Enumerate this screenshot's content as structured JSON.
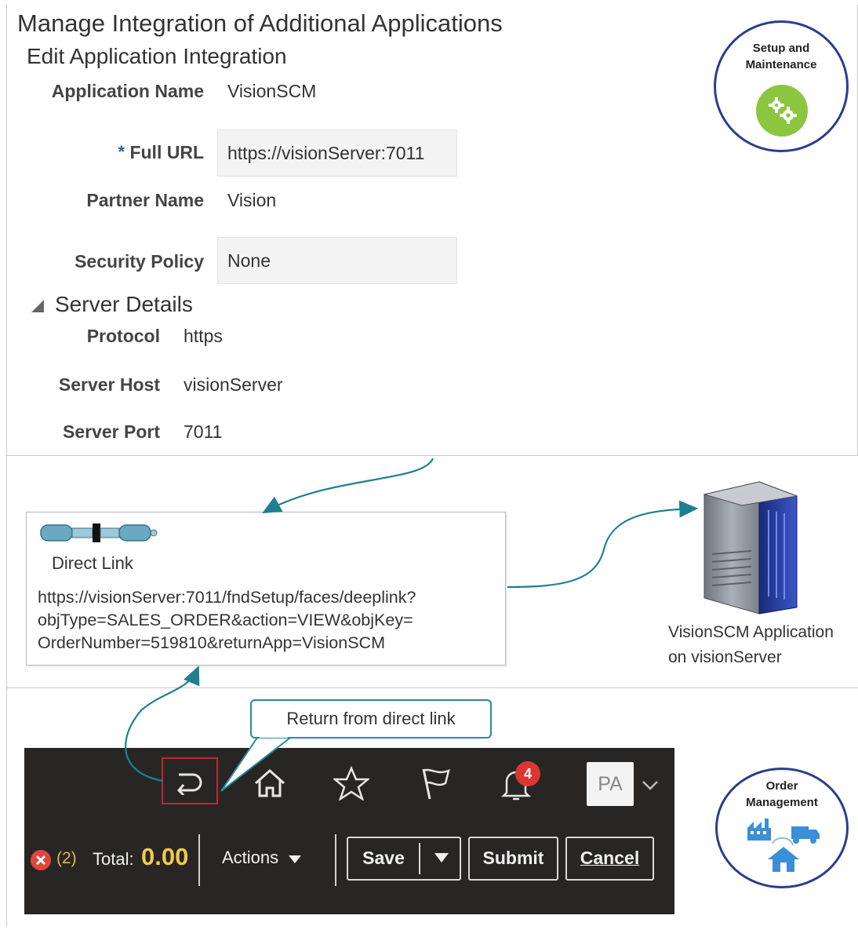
{
  "form": {
    "title": "Manage Integration of Additional Applications",
    "subtitle": "Edit Application Integration",
    "fields": [
      {
        "label": "Application Name",
        "value": "VisionSCM"
      },
      {
        "label": "Full URL",
        "required_mark": "*",
        "value": "https://visionServer:7011"
      },
      {
        "label": "Partner Name",
        "value": "Vision"
      },
      {
        "label": "Security Policy",
        "value": "None"
      }
    ],
    "server_details": {
      "title": "Server Details",
      "fields": [
        {
          "label": "Protocol",
          "value": "https"
        },
        {
          "label": "Server Host",
          "value": "visionServer"
        },
        {
          "label": "Server Port",
          "value": "7011"
        }
      ]
    }
  },
  "badges": {
    "setup": {
      "line1": "Setup and",
      "line2": "Maintenance",
      "icon": "gears-icon",
      "color": "#8cc63f"
    },
    "order": {
      "line1": "Order",
      "line2": "Management",
      "icon": "factory-truck-house-icon",
      "color": "#3b8fd6"
    }
  },
  "direct_link": {
    "label": "Direct Link",
    "icon": "cable-connector-icon",
    "url_lines": [
      "https://visionServer:7011/fndSetup/faces/deeplink?",
      "objType=SALES_ORDER&action=VIEW&objKey=",
      "OrderNumber=519810&returnApp=VisionSCM"
    ]
  },
  "server": {
    "icon": "server-tower-icon",
    "caption_line1": "VisionSCM Application",
    "caption_line2": "on visionServer"
  },
  "callout": {
    "text": "Return from direct link"
  },
  "app_header": {
    "notification_count": "4",
    "avatar_initials": "PA",
    "error_count": "(2)",
    "total_label": "Total:",
    "total_value": "0.00",
    "actions_label": "Actions",
    "save_label": "Save",
    "submit_label": "Submit",
    "cancel_label": "Cancel",
    "highlight_color": "#c0282d"
  },
  "colors": {
    "arrow": "#1f7f93",
    "toolbar_bg": "#272625",
    "total_value": "#f2c94c",
    "error": "#e0453b"
  }
}
